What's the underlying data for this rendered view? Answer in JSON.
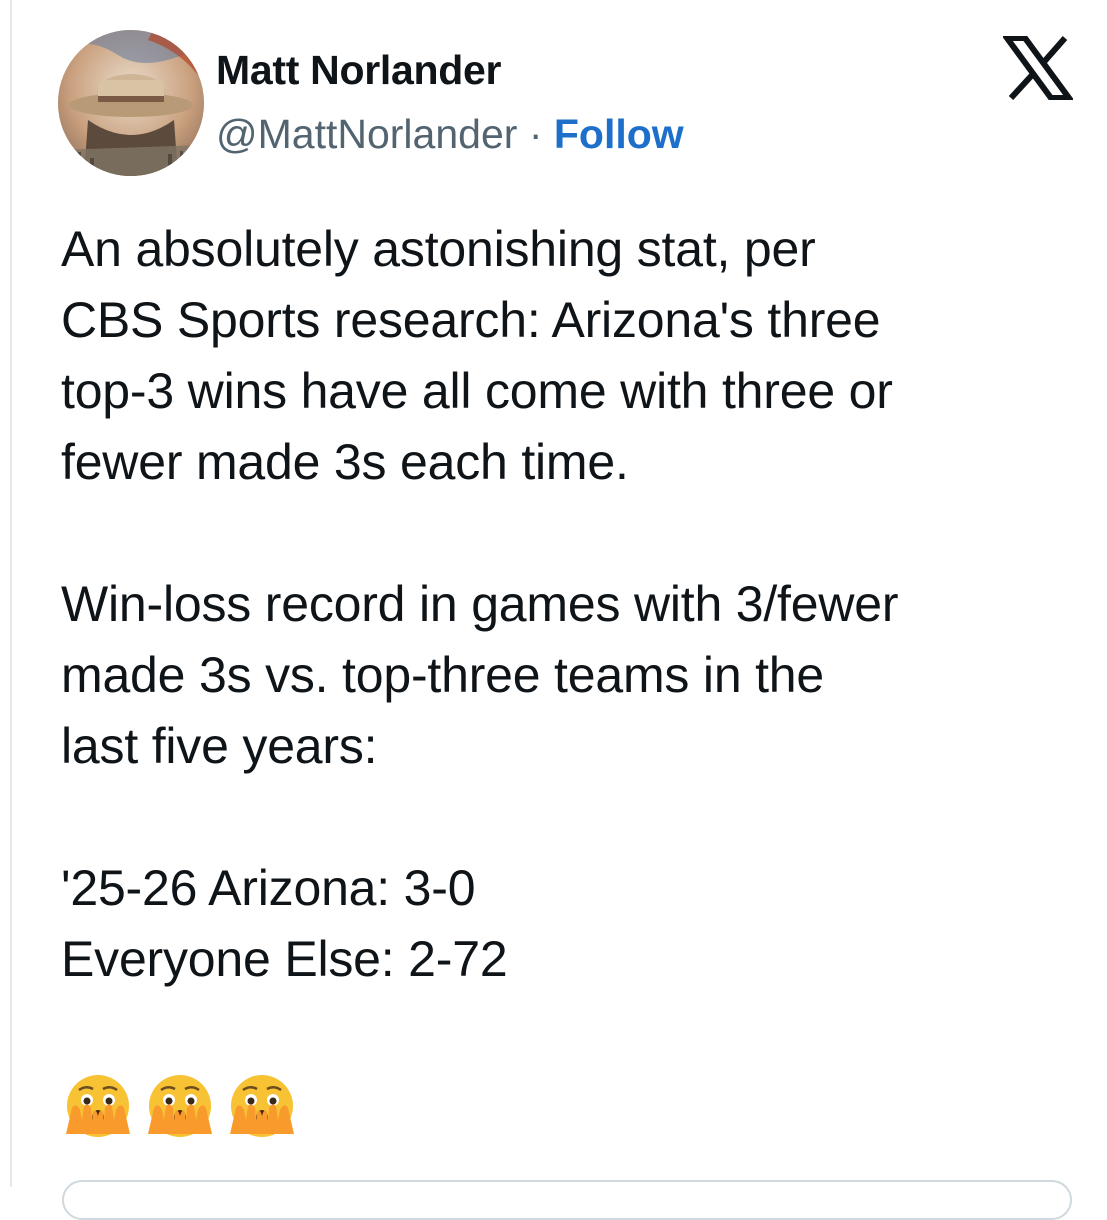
{
  "author": {
    "name": "Matt Norlander",
    "handle": "@MattNorlander",
    "separator": "·",
    "follow_label": "Follow",
    "avatar_icon": "profile-avatar-icon"
  },
  "brand": {
    "logo_icon": "x-logo-icon",
    "follow_color": "#1d6fc9",
    "secondary_text_color": "#536471"
  },
  "tweet": {
    "paragraph1": [
      "An absolutely astonishing stat, per",
      "CBS Sports research: Arizona's three",
      "top-3 wins have all come with three or",
      "fewer made 3s each time."
    ],
    "paragraph2": [
      "Win-loss record in games with 3/fewer",
      "made 3s vs. top-three teams in the",
      "last five years:"
    ],
    "paragraph3": [
      "'25-26 Arizona: 3-0",
      "Everyone Else: 2-72"
    ],
    "emojis": [
      "face-with-open-eyes-and-hand-over-mouth-icon",
      "face-with-open-eyes-and-hand-over-mouth-icon",
      "face-with-open-eyes-and-hand-over-mouth-icon"
    ]
  }
}
